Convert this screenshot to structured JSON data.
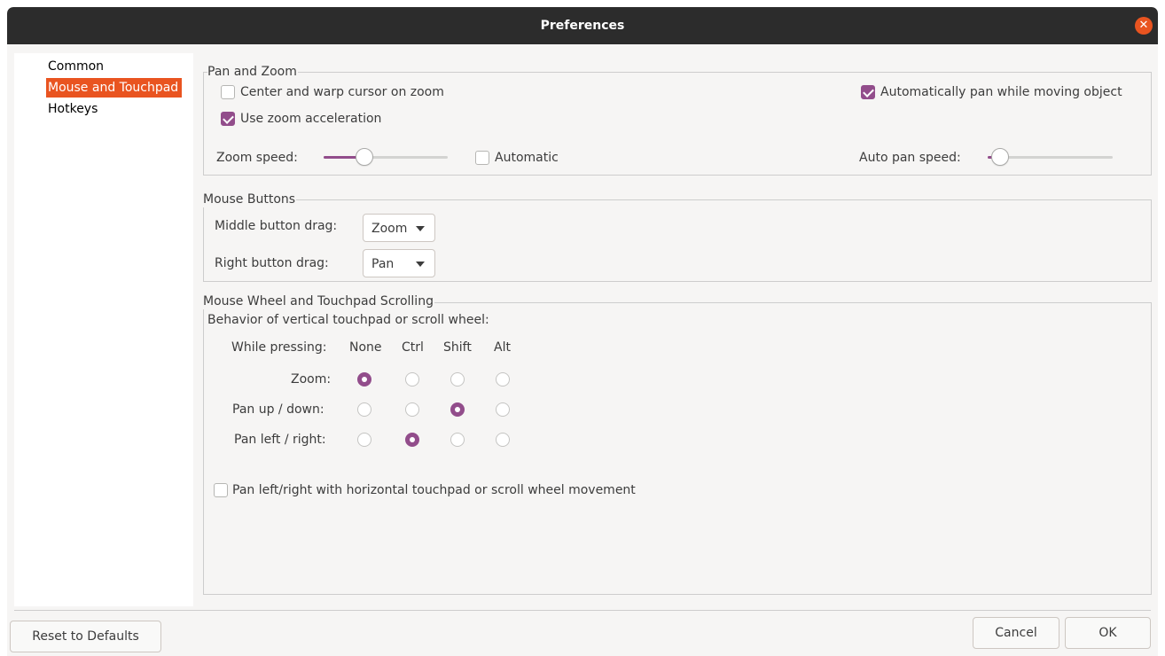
{
  "window": {
    "title": "Preferences"
  },
  "sidebar": {
    "items": [
      {
        "label": "Common",
        "selected": false
      },
      {
        "label": "Mouse and Touchpad",
        "selected": true
      },
      {
        "label": "Hotkeys",
        "selected": false
      }
    ]
  },
  "pan_zoom": {
    "title": "Pan and Zoom",
    "center_warp": {
      "label": "Center and warp cursor on zoom",
      "checked": false
    },
    "auto_pan": {
      "label": "Automatically pan while moving object",
      "checked": true
    },
    "zoom_accel": {
      "label": "Use zoom acceleration",
      "checked": true
    },
    "zoom_speed": {
      "label": "Zoom speed:",
      "value_fraction": 0.33
    },
    "automatic": {
      "label": "Automatic",
      "checked": false
    },
    "auto_pan_speed": {
      "label": "Auto pan speed:",
      "value_fraction": 0.1
    }
  },
  "mouse_buttons": {
    "title": "Mouse Buttons",
    "middle": {
      "label": "Middle button drag:",
      "value": "Zoom"
    },
    "right": {
      "label": "Right button drag:",
      "value": "Pan"
    }
  },
  "scrolling": {
    "title": "Mouse Wheel and Touchpad Scrolling",
    "subtitle": "Behavior of vertical touchpad or scroll wheel:",
    "header_label": "While pressing:",
    "columns": [
      "None",
      "Ctrl",
      "Shift",
      "Alt"
    ],
    "rows": [
      {
        "label": "Zoom:",
        "selected": "None"
      },
      {
        "label": "Pan up / down:",
        "selected": "Shift"
      },
      {
        "label": "Pan left / right:",
        "selected": "Ctrl"
      }
    ],
    "horizontal": {
      "label": "Pan left/right with horizontal touchpad or scroll wheel movement",
      "checked": false
    }
  },
  "buttons": {
    "reset": "Reset to Defaults",
    "cancel": "Cancel",
    "ok": "OK"
  },
  "colors": {
    "accent": "#924d8b",
    "selection": "#e95420",
    "titlebar": "#2c2c2c"
  },
  "icons": {
    "close": "close-icon"
  }
}
